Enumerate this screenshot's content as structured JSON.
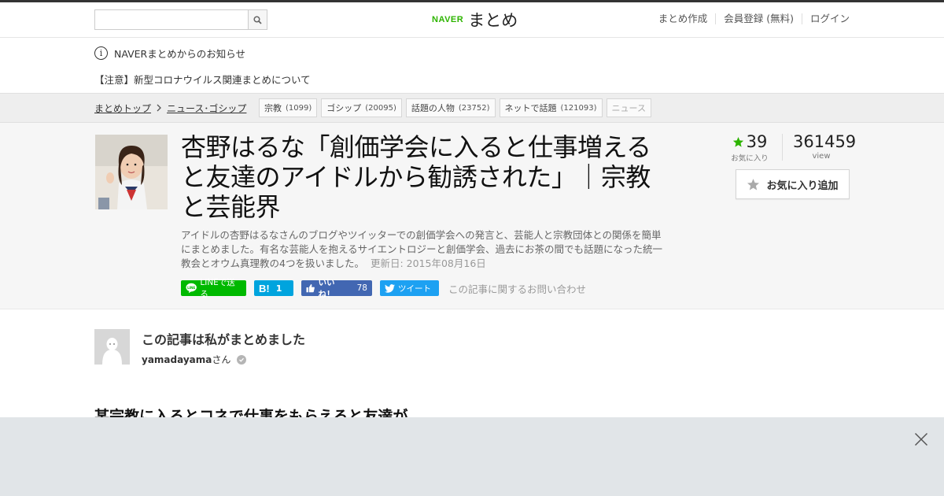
{
  "header": {
    "search": {
      "placeholder": "",
      "value": ""
    },
    "logo": {
      "brand": "NAVER",
      "name": "まとめ"
    },
    "links": [
      "まとめ作成",
      "会員登録 (無料)",
      "ログイン"
    ]
  },
  "notice": {
    "label": "NAVERまとめからのお知らせ",
    "link": "【注意】新型コロナウイルス関連まとめについて"
  },
  "breadcrumb": {
    "items": [
      "まとめトップ",
      "ニュース･ゴシップ"
    ]
  },
  "tags": [
    {
      "label": "宗教",
      "count": "(1099)"
    },
    {
      "label": "ゴシップ",
      "count": "(20095)"
    },
    {
      "label": "話題の人物",
      "count": "(23752)"
    },
    {
      "label": "ネットで話題",
      "count": "(121093)"
    },
    {
      "label": "ニュース",
      "count": ""
    }
  ],
  "article": {
    "title": "杏野はるな「創価学会に入ると仕事増えると友達のアイドルから勧誘された」｜宗教と芸能界",
    "description": "アイドルの杏野はるなさんのブログやツイッターでの創価学会への発言と、芸能人と宗教団体との関係を簡単にまとめました。有名な芸能人を抱えるサイエントロジーと創価学会、過去にお茶の間でも話題になった統一教会とオウム真理教の4つを扱いました。",
    "updated": "更新日: 2015年08月16日",
    "favorites": "39",
    "favorites_label": "お気に入り",
    "views": "361459",
    "views_label": "view",
    "fav_button": "お気に入り追加"
  },
  "share": {
    "line": "LINEで送る",
    "hatena_count": "1",
    "facebook": "いいね！",
    "facebook_count": "78",
    "twitter": "ツイート",
    "contact": "この記事に関するお問い合わせ"
  },
  "author": {
    "heading": "この記事は私がまとめました",
    "name": "yamadayama",
    "suffix": "さん"
  },
  "section": {
    "heading": "某宗教に入るとコネで仕事をもらえると友達が"
  },
  "colors": {
    "naver_green": "#2db400",
    "line": "#00b900",
    "hatena": "#00a4de",
    "facebook": "#4267b2",
    "twitter": "#1da1f2",
    "star": "#2db400"
  }
}
